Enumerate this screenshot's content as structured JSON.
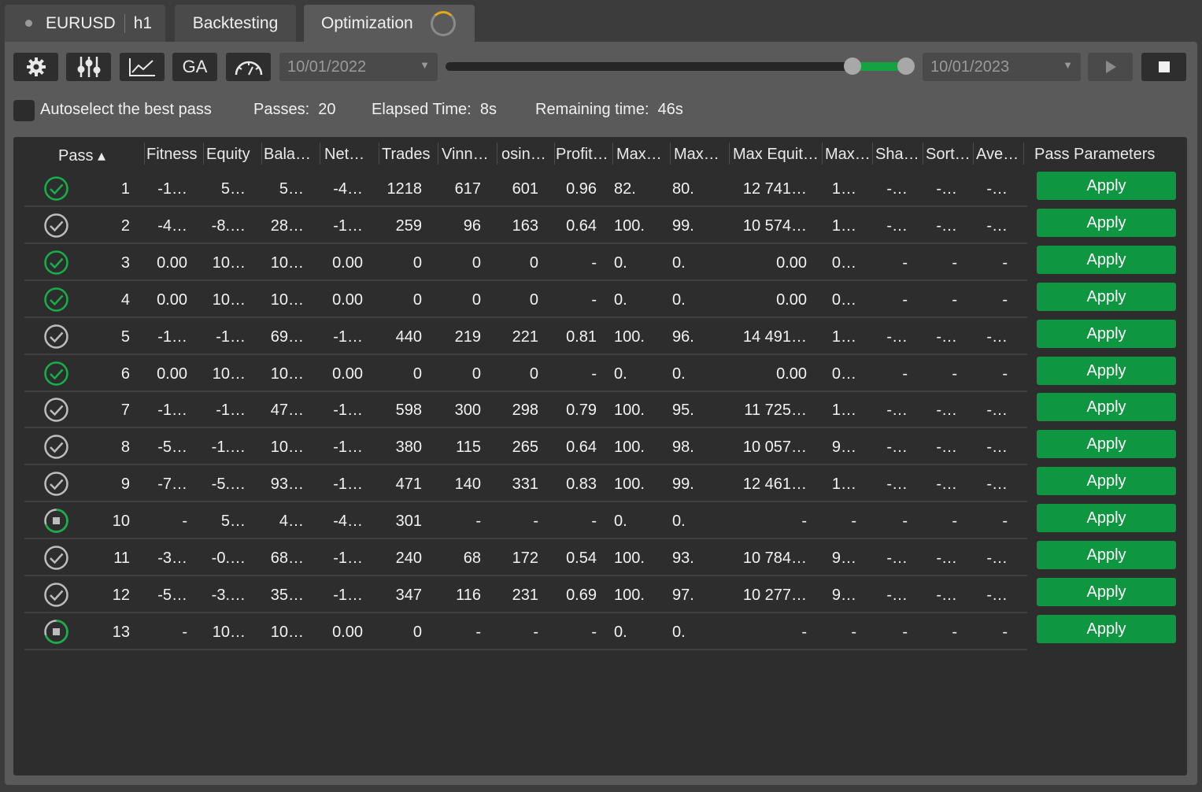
{
  "tabs": {
    "symbol": "EURUSD",
    "timeframe": "h1",
    "backtesting": "Backtesting",
    "optimization": "Optimization"
  },
  "toolbar": {
    "ga_label": "GA",
    "start_date": "10/01/2022",
    "end_date": "10/01/2023",
    "date_range_fraction": [
      0.88,
      1.0
    ]
  },
  "status": {
    "autoselect_label": "Autoselect the best pass",
    "autoselect_checked": false,
    "passes_label": "Passes:",
    "passes_value": "20",
    "elapsed_label": "Elapsed Time:",
    "elapsed_value": "8s",
    "remaining_label": "Remaining time:",
    "remaining_value": "46s"
  },
  "colors": {
    "accent_green": "#0e9640",
    "slider_green": "#14a243",
    "background": "#2d2d2d",
    "panel": "#5a5a5a"
  },
  "table": {
    "headers": [
      "Pass ▴",
      "Fitness",
      "Equity",
      "Bala…",
      "Net…",
      "Trades",
      "Vinn…",
      "osin…",
      "Profit…",
      "Max…",
      "Max…",
      "Max Equit…",
      "Max…",
      "Sha…",
      "Sort…",
      "Ave…",
      "Pass Parameters"
    ],
    "apply_label": "Apply",
    "rows": [
      {
        "status": "best",
        "cells": [
          "1",
          "-1…",
          "5…",
          "5…",
          "-4…",
          "1218",
          "617",
          "601",
          "0.96",
          "82.",
          "80.",
          "12 741…",
          "1…",
          "-…",
          "-…",
          "-…"
        ]
      },
      {
        "status": "done",
        "cells": [
          "2",
          "-4…",
          "-8.…",
          "28…",
          "-1…",
          "259",
          "96",
          "163",
          "0.64",
          "100.",
          "99.",
          "10 574…",
          "1…",
          "-…",
          "-…",
          "-…"
        ]
      },
      {
        "status": "best",
        "cells": [
          "3",
          "0.00",
          "10…",
          "10…",
          "0.00",
          "0",
          "0",
          "0",
          "-",
          "0.",
          "0.",
          "0.00",
          "0…",
          "-",
          "-",
          "-"
        ]
      },
      {
        "status": "best",
        "cells": [
          "4",
          "0.00",
          "10…",
          "10…",
          "0.00",
          "0",
          "0",
          "0",
          "-",
          "0.",
          "0.",
          "0.00",
          "0…",
          "-",
          "-",
          "-"
        ]
      },
      {
        "status": "done",
        "cells": [
          "5",
          "-1…",
          "-1…",
          "69…",
          "-1…",
          "440",
          "219",
          "221",
          "0.81",
          "100.",
          "96.",
          "14 491…",
          "1…",
          "-…",
          "-…",
          "-…"
        ]
      },
      {
        "status": "best",
        "cells": [
          "6",
          "0.00",
          "10…",
          "10…",
          "0.00",
          "0",
          "0",
          "0",
          "-",
          "0.",
          "0.",
          "0.00",
          "0…",
          "-",
          "-",
          "-"
        ]
      },
      {
        "status": "done",
        "cells": [
          "7",
          "-1…",
          "-1…",
          "47…",
          "-1…",
          "598",
          "300",
          "298",
          "0.79",
          "100.",
          "95.",
          "11 725…",
          "1…",
          "-…",
          "-…",
          "-…"
        ]
      },
      {
        "status": "done",
        "cells": [
          "8",
          "-5…",
          "-1.…",
          "10…",
          "-1…",
          "380",
          "115",
          "265",
          "0.64",
          "100.",
          "98.",
          "10 057…",
          "9…",
          "-…",
          "-…",
          "-…"
        ]
      },
      {
        "status": "done",
        "cells": [
          "9",
          "-7…",
          "-5.…",
          "93…",
          "-1…",
          "471",
          "140",
          "331",
          "0.83",
          "100.",
          "99.",
          "12 461…",
          "1…",
          "-…",
          "-…",
          "-…"
        ]
      },
      {
        "status": "running",
        "cells": [
          "10",
          "-",
          "5…",
          "4…",
          "-4…",
          "301",
          "-",
          "-",
          "-",
          "0.",
          "0.",
          "-",
          "-",
          "-",
          "-",
          "-"
        ]
      },
      {
        "status": "done",
        "cells": [
          "11",
          "-3…",
          "-0.…",
          "68…",
          "-1…",
          "240",
          "68",
          "172",
          "0.54",
          "100.",
          "93.",
          "10 784…",
          "9…",
          "-…",
          "-…",
          "-…"
        ]
      },
      {
        "status": "done",
        "cells": [
          "12",
          "-5…",
          "-3.…",
          "35…",
          "-1…",
          "347",
          "116",
          "231",
          "0.69",
          "100.",
          "97.",
          "10 277…",
          "9…",
          "-…",
          "-…",
          "-…"
        ]
      },
      {
        "status": "running",
        "cells": [
          "13",
          "-",
          "10…",
          "10…",
          "0.00",
          "0",
          "-",
          "-",
          "-",
          "0.",
          "0.",
          "-",
          "-",
          "-",
          "-",
          "-"
        ]
      }
    ]
  }
}
